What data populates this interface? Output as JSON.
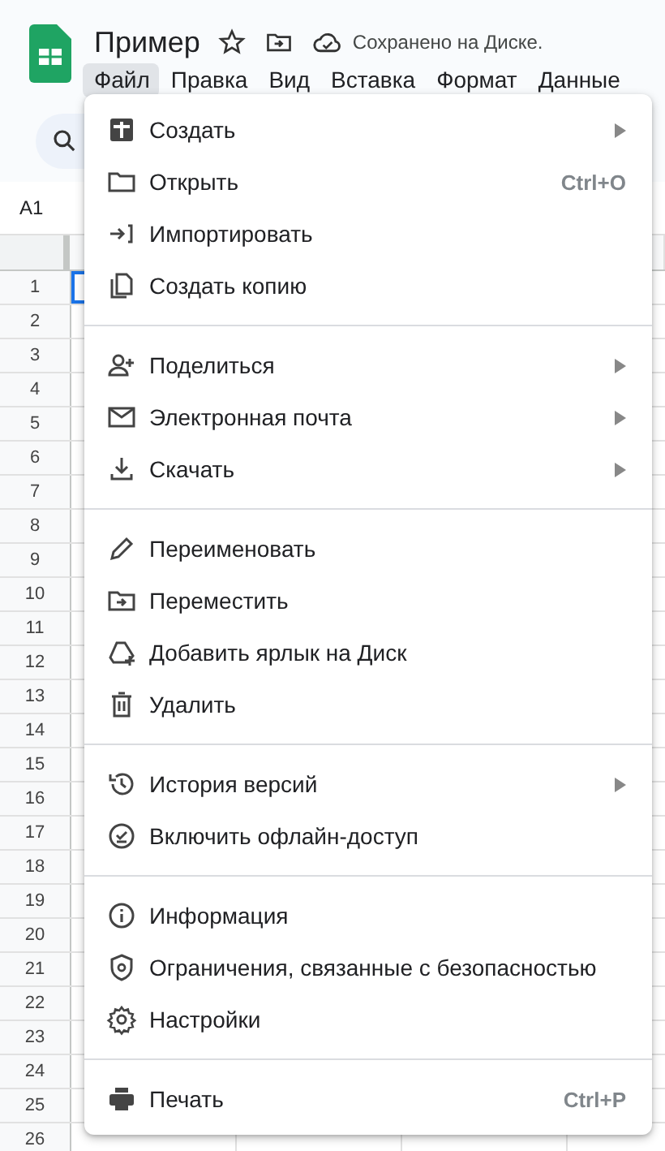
{
  "document": {
    "title": "Пример",
    "save_status": "Сохранено на Диске."
  },
  "menubar": [
    {
      "label": "Файл",
      "selected": true
    },
    {
      "label": "Правка",
      "selected": false
    },
    {
      "label": "Вид",
      "selected": false
    },
    {
      "label": "Вставка",
      "selected": false
    },
    {
      "label": "Формат",
      "selected": false
    },
    {
      "label": "Данные",
      "selected": false
    }
  ],
  "name_box": "A1",
  "grid": {
    "row_numbers": [
      "1",
      "2",
      "3",
      "4",
      "5",
      "6",
      "7",
      "8",
      "9",
      "10",
      "11",
      "12",
      "13",
      "14",
      "15",
      "16",
      "17",
      "18",
      "19",
      "20",
      "21",
      "22",
      "23",
      "24",
      "25",
      "26"
    ]
  },
  "file_menu": {
    "sections": [
      [
        {
          "label": "Создать",
          "submenu": true
        },
        {
          "label": "Открыть",
          "shortcut": "Ctrl+O"
        },
        {
          "label": "Импортировать"
        },
        {
          "label": "Создать копию"
        }
      ],
      [
        {
          "label": "Поделиться",
          "submenu": true
        },
        {
          "label": "Электронная почта",
          "submenu": true
        },
        {
          "label": "Скачать",
          "submenu": true
        }
      ],
      [
        {
          "label": "Переименовать"
        },
        {
          "label": "Переместить"
        },
        {
          "label": "Добавить ярлык на Диск"
        },
        {
          "label": "Удалить"
        }
      ],
      [
        {
          "label": "История версий",
          "submenu": true
        },
        {
          "label": "Включить офлайн-доступ"
        }
      ],
      [
        {
          "label": "Информация"
        },
        {
          "label": "Ограничения, связанные с безопасностью"
        },
        {
          "label": "Настройки"
        }
      ],
      [
        {
          "label": "Печать",
          "shortcut": "Ctrl+P"
        }
      ]
    ]
  }
}
